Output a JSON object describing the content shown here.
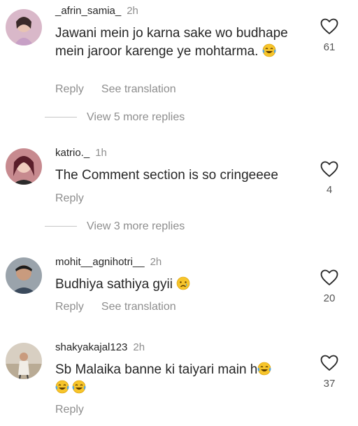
{
  "comments": [
    {
      "username": "_afrin_samia_",
      "time": "2h",
      "text": "Jawani mein jo karna sake wo budhape mein jaroor karenge ye mohtarma.",
      "emojis": [
        "laughing-tears"
      ],
      "likes": "61",
      "reply_label": "Reply",
      "translate_label": "See translation",
      "view_more": "View 5 more replies"
    },
    {
      "username": "katrio._",
      "time": "1h",
      "text": "The Comment section is so cringeeee",
      "emojis": [],
      "likes": "4",
      "reply_label": "Reply",
      "view_more": "View 3 more replies"
    },
    {
      "username": "mohit__agnihotri__",
      "time": "2h",
      "text": "Budhiya sathiya gyii",
      "emojis": [
        "crying"
      ],
      "likes": "20",
      "reply_label": "Reply",
      "translate_label": "See translation"
    },
    {
      "username": "shakyakajal123",
      "time": "2h",
      "text": "Sb Malaika banne ki taiyari main h",
      "emojis": [
        "laughing-tears",
        "laughing-tears",
        "laughing-tears"
      ],
      "likes": "37",
      "reply_label": "Reply"
    }
  ],
  "icons": {
    "like": "heart-outline-icon",
    "emoji_laugh": "face-with-tears-of-joy",
    "emoji_cry": "crying-face"
  }
}
